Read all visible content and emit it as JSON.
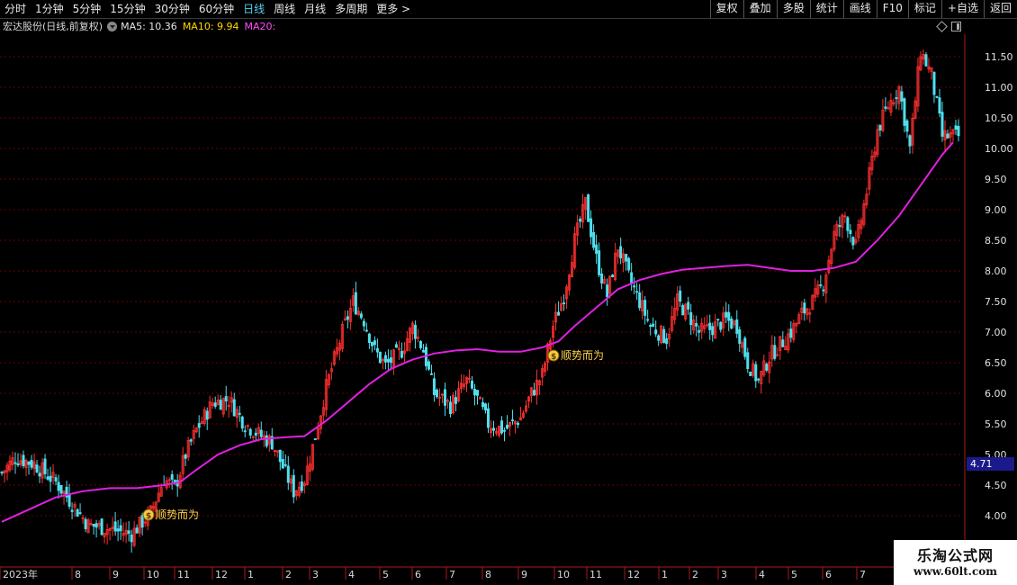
{
  "toolbar": {
    "tabs": [
      "分时",
      "1分钟",
      "5分钟",
      "15分钟",
      "30分钟",
      "60分钟",
      "日线",
      "周线",
      "月线",
      "多周期",
      "更多 >"
    ],
    "active_tab": "日线",
    "buttons": [
      "复权",
      "叠加",
      "多股",
      "统计",
      "画线",
      "F10",
      "标记",
      "+自选",
      "返回"
    ]
  },
  "info": {
    "stock": "宏达股份(日线,前复权)",
    "ma5": "MA5: 10.36",
    "ma10": "MA10: 9.94",
    "ma20": "MA20:"
  },
  "signals": [
    {
      "label": "顺势而为",
      "date": "2023-10"
    },
    {
      "label": "顺势而为",
      "date": "2024-10"
    }
  ],
  "current_price": "4.71",
  "watermark": {
    "line1": "乐淘公式网",
    "line2": "www.60lt.com"
  },
  "colors": {
    "up": "#ff3030",
    "down": "#4ee0ee",
    "ma_long": "#e020e0",
    "grid": "#6a0000",
    "axis": "#b01818",
    "label": "#ffd24a"
  },
  "chart_data": {
    "type": "candlestick",
    "y_ticks": [
      "11.50",
      "11.00",
      "10.50",
      "10.00",
      "9.50",
      "9.00",
      "8.50",
      "8.00",
      "7.50",
      "7.00",
      "6.50",
      "6.00",
      "5.50",
      "5.00",
      "4.50",
      "4.00"
    ],
    "x_ticks": [
      "2023年",
      "8",
      "9",
      "10",
      "11",
      "12",
      "1",
      "2",
      "3",
      "4",
      "5",
      "6",
      "7",
      "8",
      "9",
      "10",
      "11",
      "12",
      "1",
      "2",
      "3",
      "4",
      "5",
      "6",
      "7"
    ],
    "ylim": [
      3.6,
      11.9
    ],
    "close_trend": [
      [
        0,
        4.7
      ],
      [
        5,
        4.95
      ],
      [
        12,
        4.85
      ],
      [
        20,
        4.55
      ],
      [
        26,
        4.2
      ],
      [
        32,
        3.85
      ],
      [
        38,
        3.8
      ],
      [
        43,
        3.75
      ],
      [
        48,
        3.7
      ],
      [
        55,
        4.05
      ],
      [
        60,
        4.6
      ],
      [
        64,
        4.45
      ],
      [
        68,
        5.0
      ],
      [
        72,
        5.4
      ],
      [
        78,
        5.85
      ],
      [
        84,
        5.9
      ],
      [
        90,
        5.5
      ],
      [
        96,
        5.3
      ],
      [
        100,
        5.2
      ],
      [
        104,
        4.8
      ],
      [
        108,
        4.4
      ],
      [
        112,
        4.6
      ],
      [
        116,
        5.3
      ],
      [
        120,
        6.1
      ],
      [
        126,
        7.0
      ],
      [
        130,
        7.5
      ],
      [
        134,
        7.2
      ],
      [
        138,
        6.7
      ],
      [
        142,
        6.45
      ],
      [
        148,
        6.7
      ],
      [
        152,
        7.1
      ],
      [
        156,
        6.7
      ],
      [
        160,
        6.0
      ],
      [
        166,
        5.8
      ],
      [
        172,
        6.2
      ],
      [
        176,
        5.9
      ],
      [
        180,
        5.5
      ],
      [
        186,
        5.4
      ],
      [
        192,
        5.6
      ],
      [
        196,
        6.0
      ],
      [
        200,
        6.3
      ],
      [
        204,
        7.1
      ],
      [
        208,
        7.6
      ],
      [
        212,
        8.5
      ],
      [
        216,
        9.1
      ],
      [
        220,
        8.2
      ],
      [
        224,
        7.6
      ],
      [
        228,
        8.4
      ],
      [
        232,
        7.9
      ],
      [
        236,
        7.5
      ],
      [
        240,
        7.1
      ],
      [
        246,
        6.9
      ],
      [
        250,
        7.5
      ],
      [
        254,
        7.3
      ],
      [
        258,
        7.0
      ],
      [
        262,
        7.05
      ],
      [
        268,
        7.2
      ],
      [
        272,
        7.1
      ],
      [
        276,
        6.5
      ],
      [
        280,
        6.2
      ],
      [
        284,
        6.6
      ],
      [
        288,
        6.8
      ],
      [
        292,
        7.0
      ],
      [
        296,
        7.3
      ],
      [
        300,
        7.5
      ],
      [
        304,
        7.8
      ],
      [
        308,
        8.6
      ],
      [
        312,
        8.9
      ],
      [
        316,
        8.4
      ],
      [
        320,
        9.3
      ],
      [
        324,
        10.3
      ],
      [
        328,
        10.7
      ],
      [
        332,
        11.0
      ],
      [
        336,
        10.0
      ],
      [
        340,
        11.6
      ],
      [
        344,
        11.2
      ],
      [
        348,
        10.2
      ]
    ],
    "ma_long_trend": [
      [
        0,
        3.9
      ],
      [
        10,
        4.1
      ],
      [
        20,
        4.3
      ],
      [
        30,
        4.4
      ],
      [
        40,
        4.45
      ],
      [
        50,
        4.45
      ],
      [
        60,
        4.5
      ],
      [
        66,
        4.55
      ],
      [
        72,
        4.75
      ],
      [
        80,
        5.0
      ],
      [
        88,
        5.15
      ],
      [
        96,
        5.25
      ],
      [
        104,
        5.28
      ],
      [
        112,
        5.3
      ],
      [
        120,
        5.55
      ],
      [
        128,
        5.85
      ],
      [
        136,
        6.15
      ],
      [
        144,
        6.4
      ],
      [
        152,
        6.55
      ],
      [
        160,
        6.65
      ],
      [
        168,
        6.7
      ],
      [
        176,
        6.72
      ],
      [
        184,
        6.68
      ],
      [
        192,
        6.68
      ],
      [
        200,
        6.75
      ],
      [
        206,
        6.85
      ],
      [
        212,
        7.1
      ],
      [
        220,
        7.4
      ],
      [
        228,
        7.7
      ],
      [
        236,
        7.85
      ],
      [
        244,
        7.95
      ],
      [
        252,
        8.02
      ],
      [
        260,
        8.05
      ],
      [
        268,
        8.08
      ],
      [
        276,
        8.1
      ],
      [
        284,
        8.05
      ],
      [
        292,
        8.0
      ],
      [
        300,
        8.0
      ],
      [
        308,
        8.05
      ],
      [
        316,
        8.15
      ],
      [
        324,
        8.5
      ],
      [
        332,
        8.9
      ],
      [
        340,
        9.4
      ],
      [
        348,
        9.9
      ],
      [
        352,
        10.1
      ]
    ]
  }
}
